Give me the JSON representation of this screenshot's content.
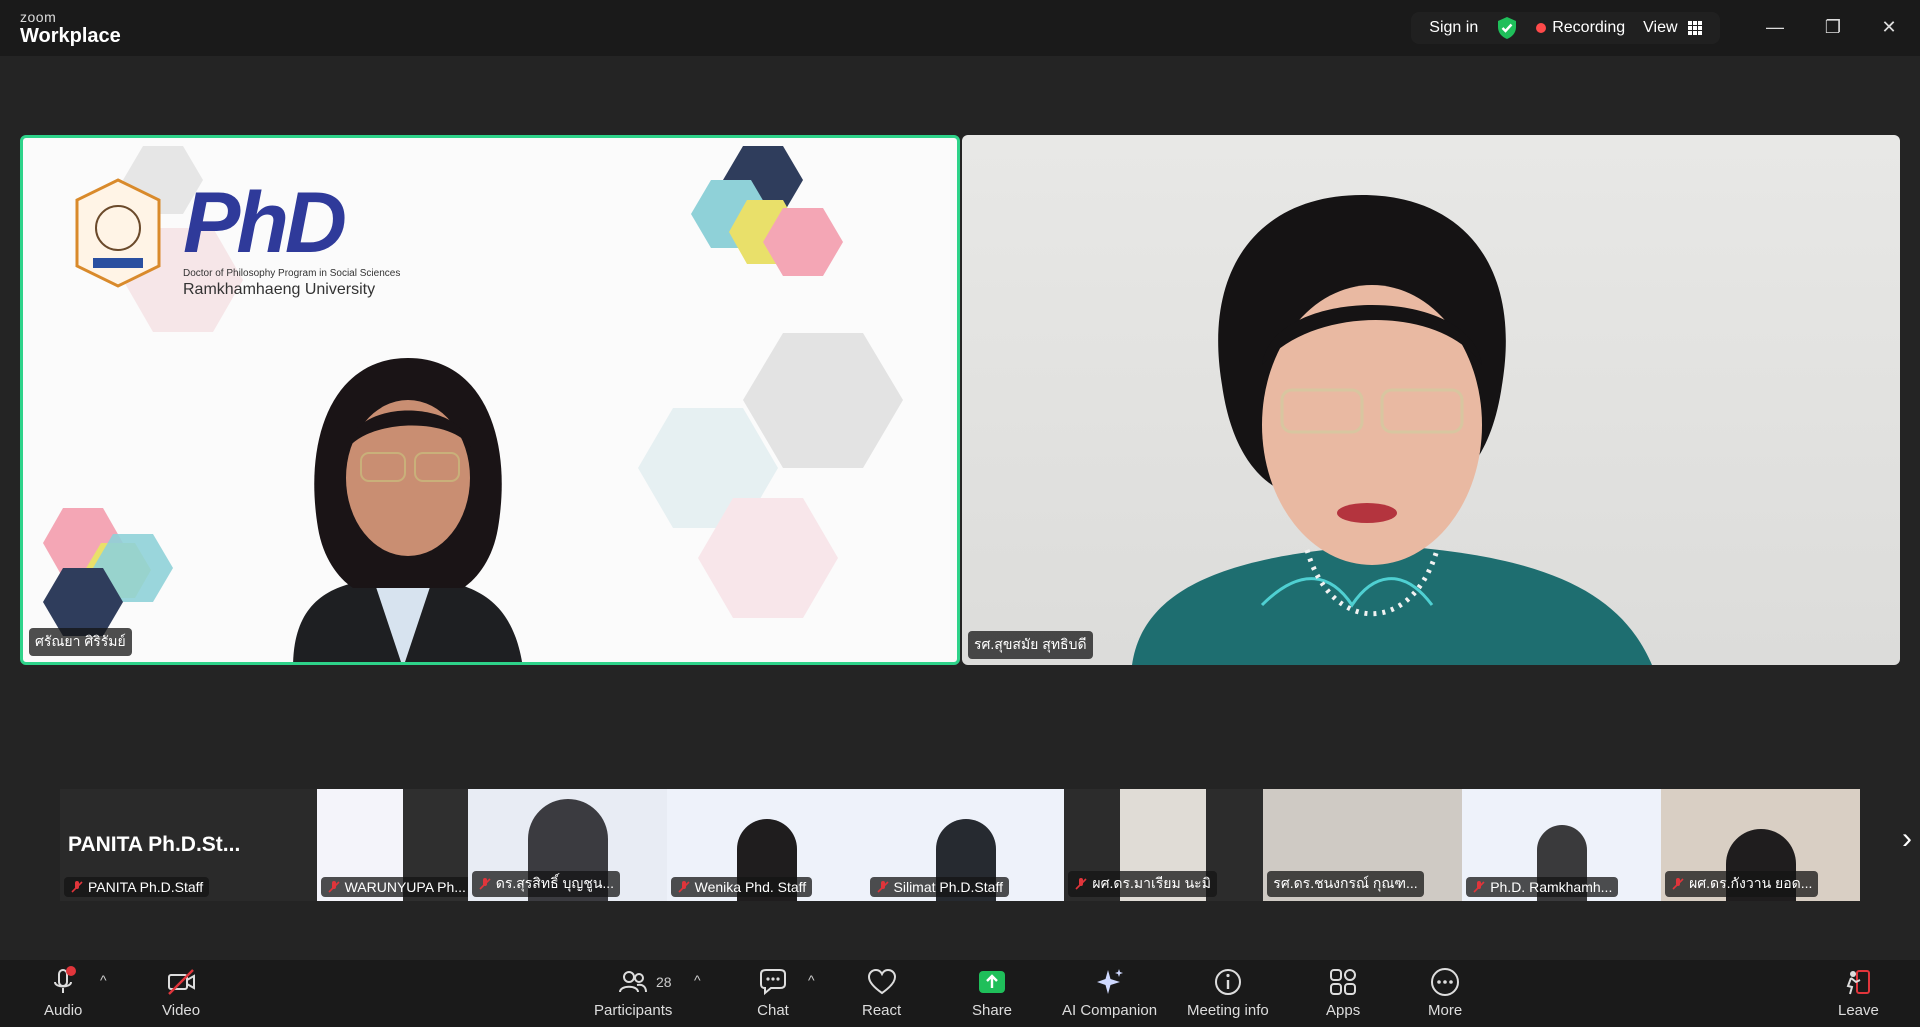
{
  "app": {
    "logo_line1": "zoom",
    "logo_line2": "Workplace"
  },
  "titlebar": {
    "sign_in": "Sign in",
    "recording": "Recording",
    "view": "View"
  },
  "main_tiles": [
    {
      "name": "ศรัณยา ศิริรัมย์",
      "logo_main": "PhD",
      "logo_sub1": "Doctor of Philosophy Program in Social Sciences",
      "logo_sub2": "Ramkhamhaeng University"
    },
    {
      "name": "รศ.สุขสมัย สุทธิบดี"
    }
  ],
  "thumbnails": [
    {
      "name": "PANITA Ph.D.Staff",
      "big_label": "PANITA  Ph.D.St..."
    },
    {
      "name": "WARUNYUPA Ph..."
    },
    {
      "name": "ดร.สุรสิทธิ์  บุญชูน..."
    },
    {
      "name": "Wenika Phd. Staff"
    },
    {
      "name": "Silimat Ph.D.Staff"
    },
    {
      "name": "ผศ.ดร.มาเรียม  นะมิ"
    },
    {
      "name": "รศ.ดร.ชนงกรณ์  กุณฑ..."
    },
    {
      "name": "Ph.D. Ramkhamh..."
    },
    {
      "name": "ผศ.ดร.กังวาน  ยอด..."
    }
  ],
  "toolbar": {
    "audio": "Audio",
    "video": "Video",
    "participants": "Participants",
    "participants_count": "28",
    "chat": "Chat",
    "react": "React",
    "share": "Share",
    "ai_companion": "AI Companion",
    "meeting_info": "Meeting info",
    "apps": "Apps",
    "more": "More",
    "leave": "Leave"
  },
  "colors": {
    "accent_green": "#2ed38a",
    "recording_red": "#ff4a4a",
    "share_green": "#1fbf5a",
    "leave_red": "#e0353b"
  }
}
